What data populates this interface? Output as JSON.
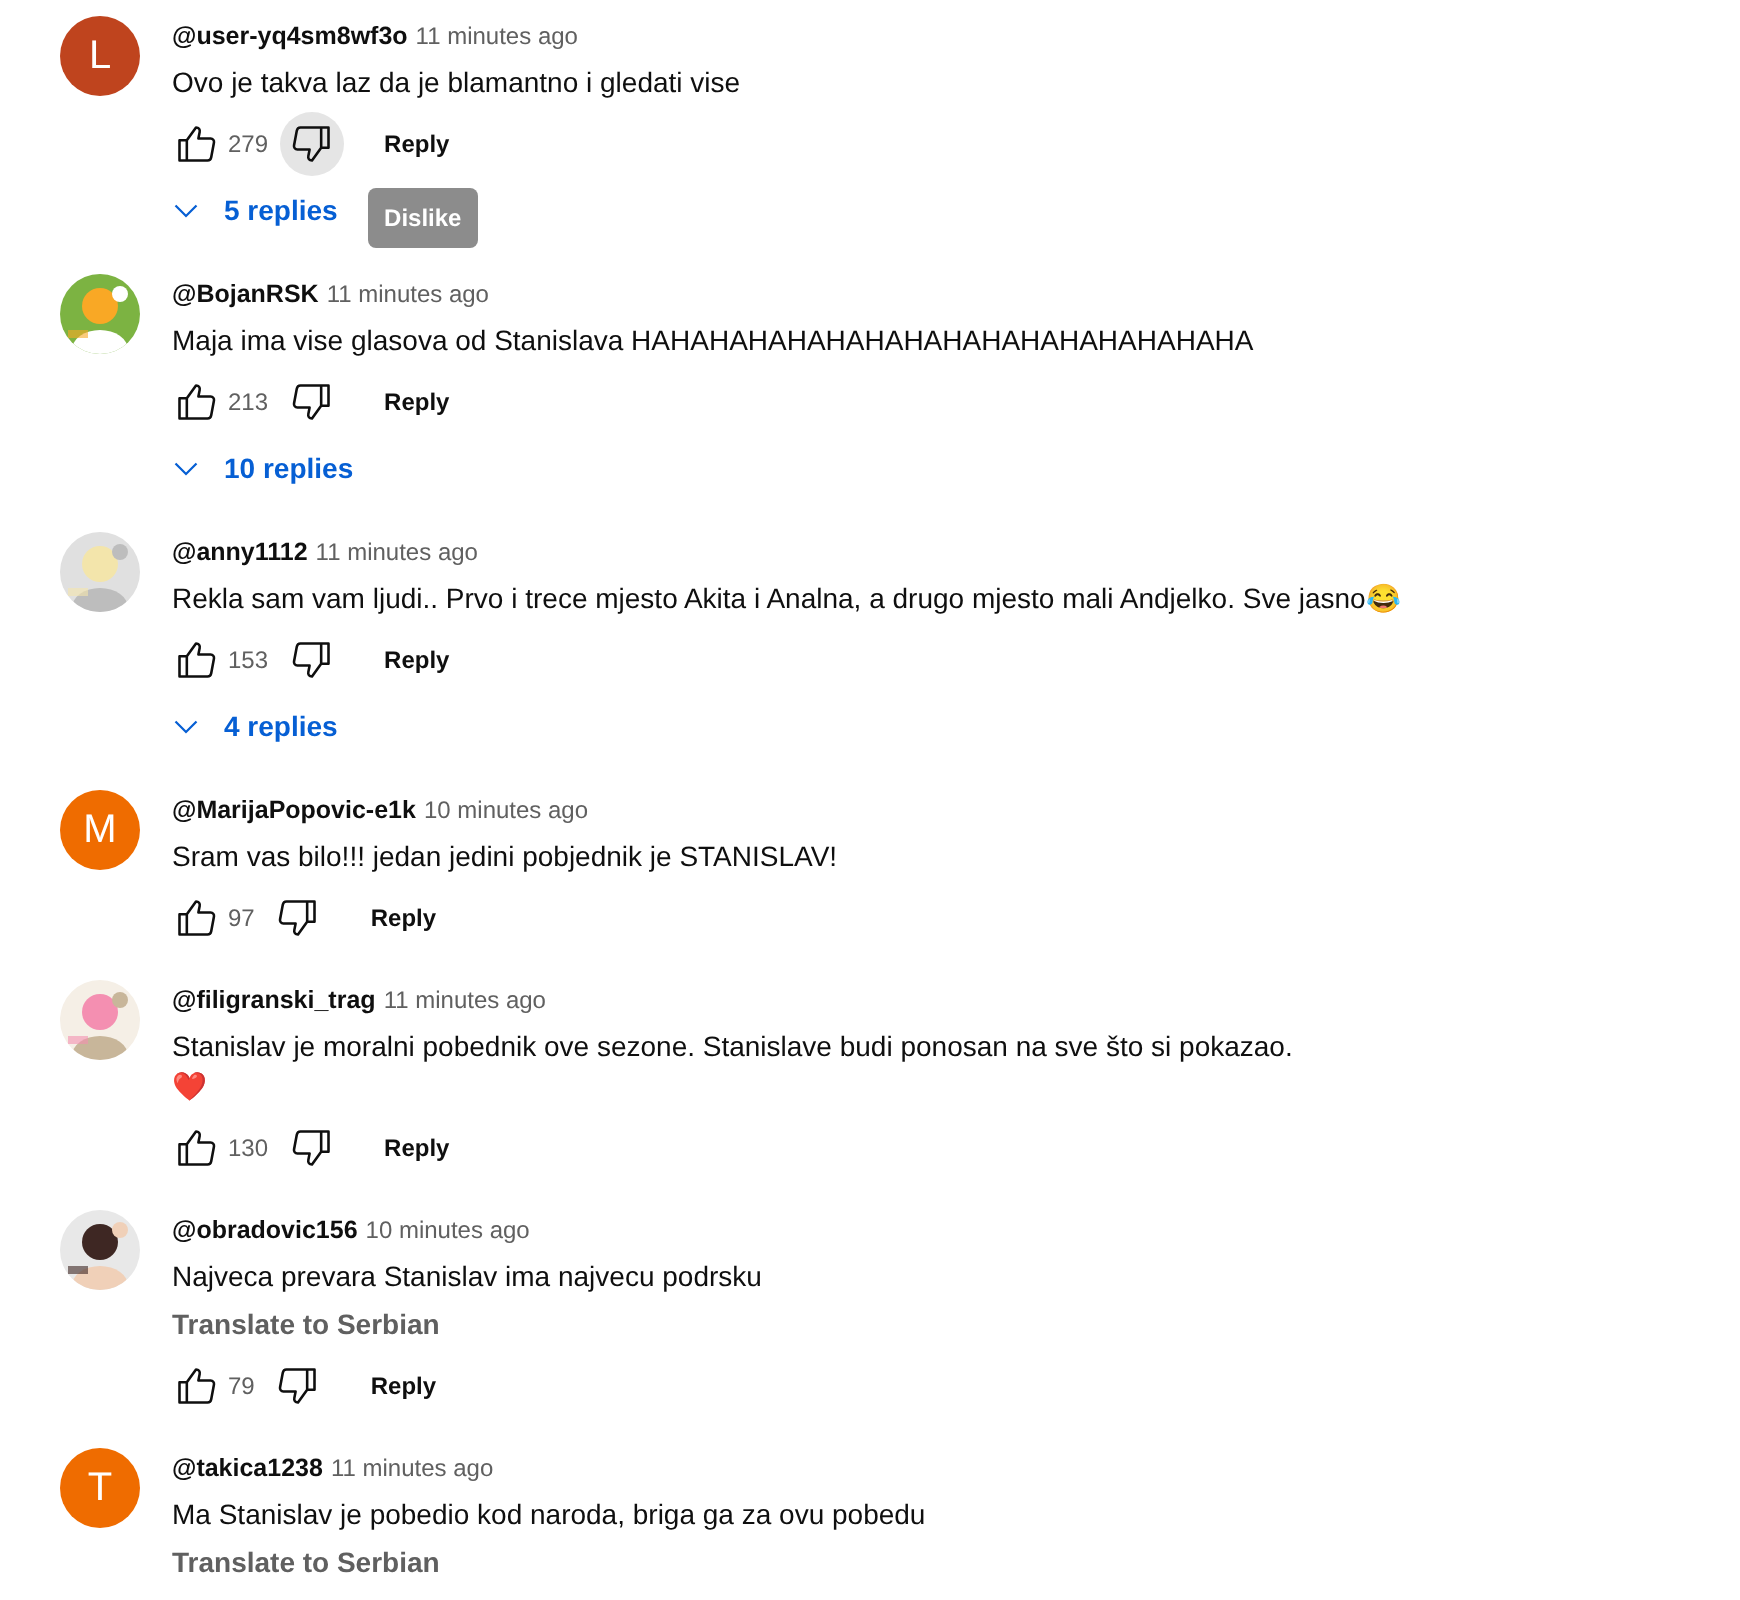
{
  "comments": [
    {
      "author": "@user-yq4sm8wf3o",
      "time": "11 minutes ago",
      "avatar": {
        "kind": "letter",
        "letter": "L",
        "color": "#bf441e"
      },
      "text": [
        "Ovo je takva laz da je blamantno i gledati vise"
      ],
      "likes": "279",
      "dislike_hovered": true,
      "tooltip": "Dislike",
      "reply": "Reply",
      "replies": "5 replies"
    },
    {
      "author": "@BojanRSK",
      "time": "11 minutes ago",
      "avatar": {
        "kind": "picture"
      },
      "text": [
        "Maja ima vise glasova od Stanislava HAHAHAHAHAHAHAHAHAHAHAHAHAHAHAHA"
      ],
      "likes": "213",
      "dislike_hovered": false,
      "reply": "Reply",
      "replies": "10 replies"
    },
    {
      "author": "@anny1112",
      "time": "11 minutes ago",
      "avatar": {
        "kind": "picture"
      },
      "text": [
        "Rekla sam vam ljudi.. Prvo i trece mjesto Akita i Analna, a drugo mjesto mali Andjelko. Sve jasno😂"
      ],
      "likes": "153",
      "dislike_hovered": false,
      "reply": "Reply",
      "replies": "4 replies"
    },
    {
      "author": "@MarijaPopovic-e1k",
      "time": "10 minutes ago",
      "avatar": {
        "kind": "letter",
        "letter": "M",
        "color": "#ef6c00"
      },
      "text": [
        "Sram vas bilo!!! jedan jedini pobjednik je STANISLAV!"
      ],
      "likes": "97",
      "dislike_hovered": false,
      "reply": "Reply"
    },
    {
      "author": "@filigranski_trag",
      "time": "11 minutes ago",
      "avatar": {
        "kind": "picture"
      },
      "text": [
        "Stanislav je moralni pobednik ove sezone. Stanislave budi ponosan na sve što si pokazao.",
        "❤️"
      ],
      "likes": "130",
      "dislike_hovered": false,
      "reply": "Reply"
    },
    {
      "author": "@obradovic156",
      "time": "10 minutes ago",
      "avatar": {
        "kind": "picture"
      },
      "text": [
        "Najveca prevara Stanislav ima najvecu podrsku"
      ],
      "translate": "Translate to Serbian",
      "likes": "79",
      "dislike_hovered": false,
      "reply": "Reply"
    },
    {
      "author": "@takica1238",
      "time": "11 minutes ago",
      "avatar": {
        "kind": "letter",
        "letter": "T",
        "color": "#ef6c00"
      },
      "text": [
        "Ma Stanislav je pobedio kod naroda, briga ga za ovu pobedu"
      ],
      "translate": "Translate to Serbian"
    }
  ]
}
